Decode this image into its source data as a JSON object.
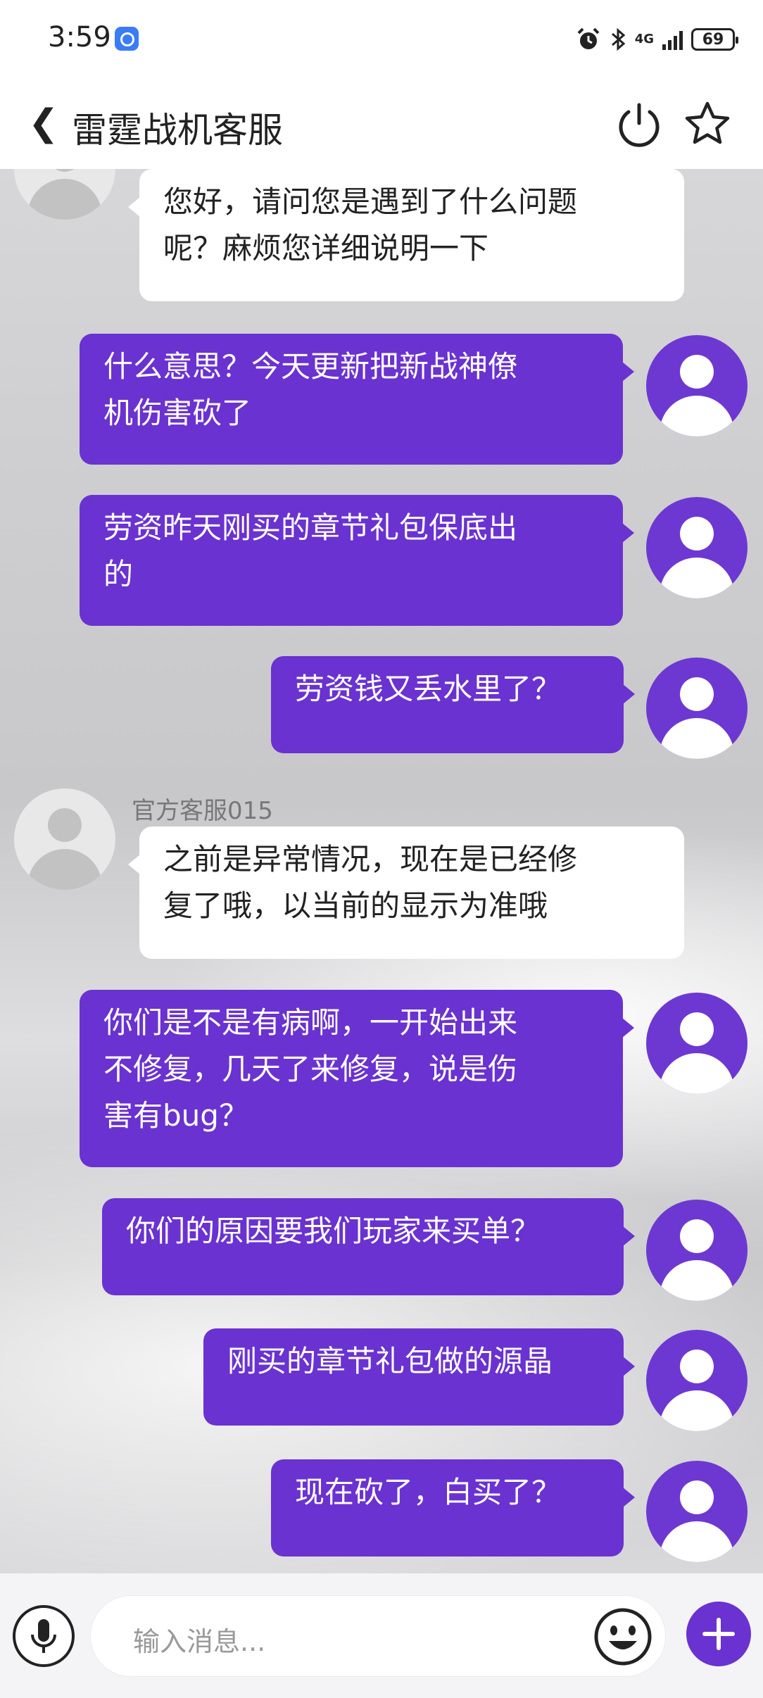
{
  "status_bar": {
    "time": "3:59",
    "network": "4G",
    "battery": "69"
  },
  "header": {
    "back_glyph": "❮",
    "title": "雷霆战机客服",
    "power_icon": "power-icon",
    "star_icon": "star-icon"
  },
  "messages": [
    {
      "side": "in",
      "sender": "",
      "text": "您好，请问您是遇到了什么问题\n呢？麻烦您详细说明一下"
    },
    {
      "side": "out",
      "text": "什么意思？今天更新把新战神僚\n机伤害砍了"
    },
    {
      "side": "out",
      "text": "劳资昨天刚买的章节礼包保底出\n的"
    },
    {
      "side": "out",
      "text": "劳资钱又丢水里了？"
    },
    {
      "side": "in",
      "sender": "官方客服015",
      "text": "之前是异常情况，现在是已经修\n复了哦，以当前的显示为准哦"
    },
    {
      "side": "out",
      "text": "你们是不是有病啊，一开始出来\n不修复，几天了来修复，说是伤\n害有bug？"
    },
    {
      "side": "out",
      "text": "你们的原因要我们玩家来买单？"
    },
    {
      "side": "out",
      "text": "刚买的章节礼包做的源晶"
    },
    {
      "side": "out",
      "text": "现在砍了，白买了？"
    }
  ],
  "input": {
    "placeholder": "输入消息..."
  },
  "colors": {
    "accent": "#6a32d0",
    "incoming_bubble": "#ffffff"
  }
}
